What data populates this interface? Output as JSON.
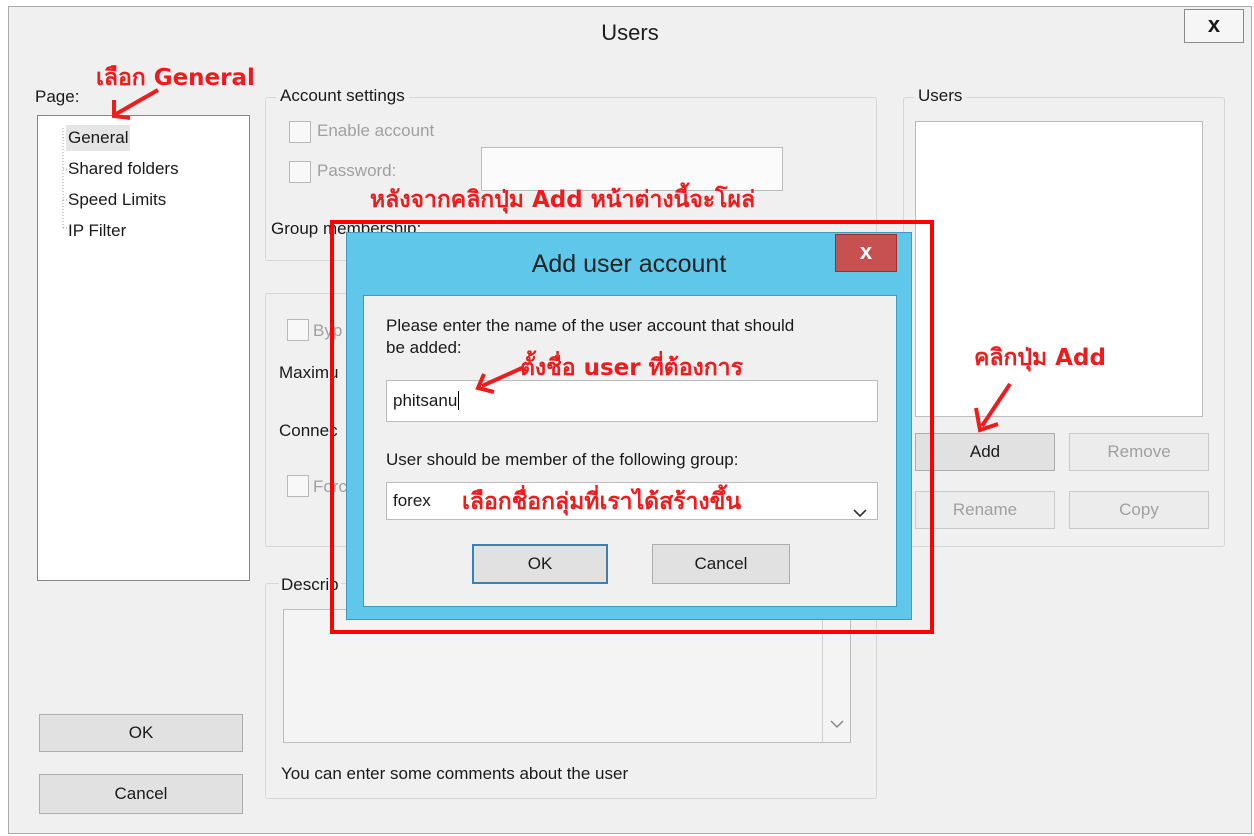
{
  "window": {
    "title": "Users",
    "close_glyph": "x"
  },
  "page_panel": {
    "label": "Page:",
    "tree_items": [
      "General",
      "Shared folders",
      "Speed Limits",
      "IP Filter"
    ],
    "ok_label": "OK",
    "cancel_label": "Cancel"
  },
  "account_settings": {
    "title": "Account settings",
    "enable_account": "Enable account",
    "password": "Password:",
    "group_membership": "Group membership:"
  },
  "middle_group": {
    "bypass": "Byp",
    "maximum": "Maximu",
    "connections": "Connec",
    "force": "Forc"
  },
  "description": {
    "title": "Descrip",
    "hint": "You can enter some comments about the user"
  },
  "users_panel": {
    "title": "Users",
    "add": "Add",
    "remove": "Remove",
    "rename": "Rename",
    "copy": "Copy"
  },
  "dialog": {
    "title": "Add user account",
    "close_glyph": "x",
    "prompt_line1": "Please enter the name of the user account that should",
    "prompt_line2": "be added:",
    "username_value": "phitsanu",
    "group_label": "User should be member of the following group:",
    "group_selected": "forex",
    "ok": "OK",
    "cancel": "Cancel"
  },
  "annotations": {
    "select_general": "เลือก General",
    "after_click_add": "หลังจากคลิกปุ่ม Add หน้าต่างนี้จะโผล่",
    "click_add": "คลิกปุ่ม Add",
    "set_user_name": "ตั้งชื่อ user ที่ต้องการ",
    "select_group": "เลือกชื่อกลุ่มที่เราได้สร้างขึ้น"
  },
  "colors": {
    "annotation_red": "#ee1c1c",
    "dialog_frame": "#5fc7ea",
    "close_red": "#c75050"
  },
  "icons": [
    "chevron-down-icon",
    "close-icon",
    "arrow-annotation-icon"
  ]
}
